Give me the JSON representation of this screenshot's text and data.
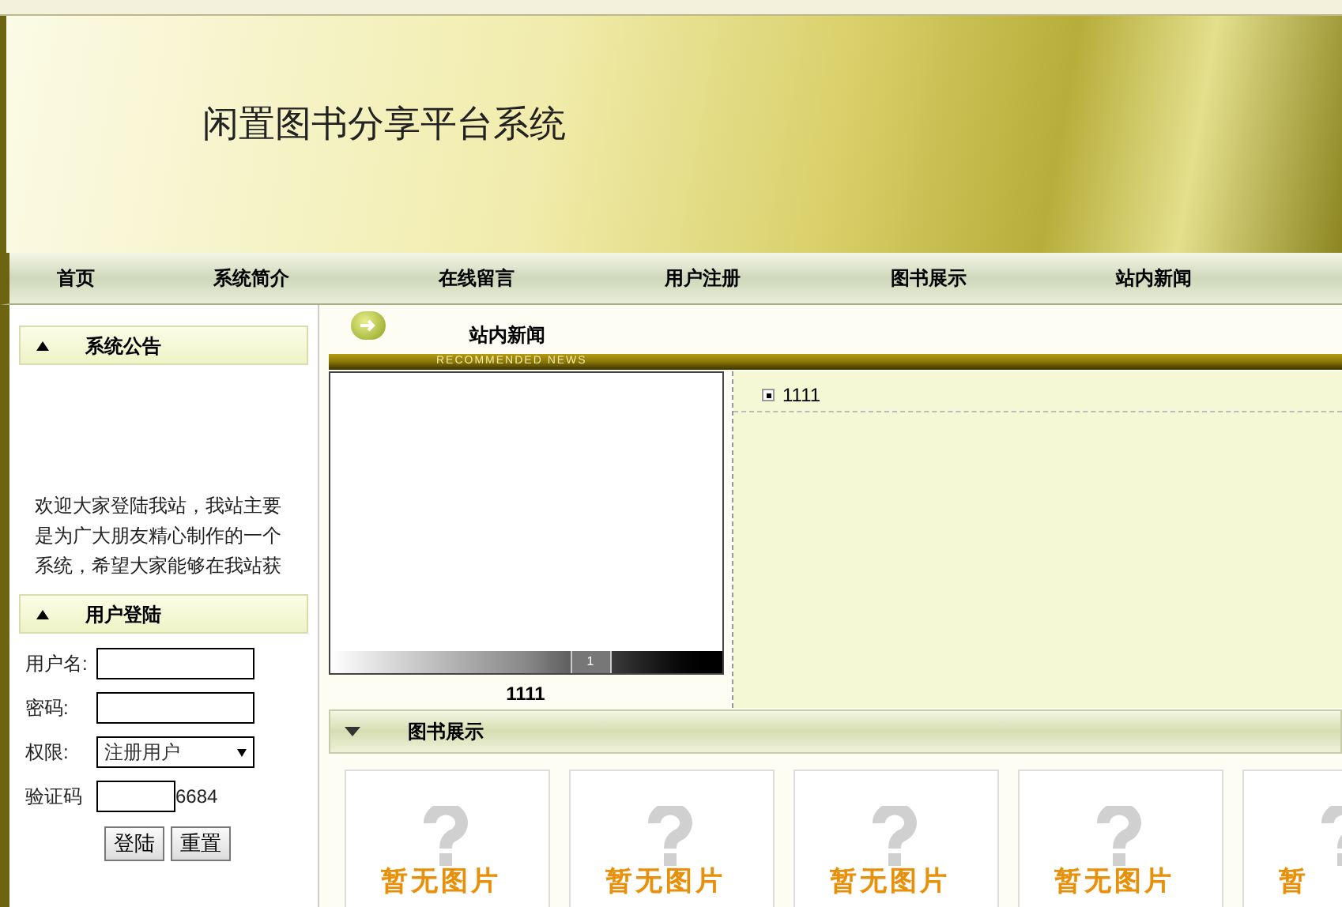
{
  "header": {
    "title": "闲置图书分享平台系统"
  },
  "nav": [
    {
      "label": "首页"
    },
    {
      "label": "系统简介"
    },
    {
      "label": "在线留言"
    },
    {
      "label": "用户注册"
    },
    {
      "label": "图书展示"
    },
    {
      "label": "站内新闻"
    }
  ],
  "announcement": {
    "title": "系统公告",
    "text": "欢迎大家登陆我站，我站主要是为广大朋友精心制作的一个系统，希望大家能够在我站获"
  },
  "login": {
    "title": "用户登陆",
    "fields": [
      {
        "kind": "text",
        "label": "用户名:"
      },
      {
        "kind": "password",
        "label": "密码:"
      },
      {
        "kind": "select",
        "label": "权限:",
        "value": "注册用户"
      },
      {
        "kind": "captcha",
        "label": "验证码",
        "code": "6684"
      }
    ],
    "buttons": [
      "登陆",
      "重置"
    ]
  },
  "news": {
    "title": "站内新闻",
    "subtitle": "RECOMMENDED NEWS",
    "slideshow": {
      "pages": [
        {
          "label": "1",
          "selected": true
        }
      ],
      "caption": "1111"
    },
    "items": [
      "1111"
    ]
  },
  "books": {
    "title": "图书展示",
    "items": [
      {
        "caption": "暂无图片"
      },
      {
        "caption": "暂无图片"
      },
      {
        "caption": "暂无图片"
      },
      {
        "caption": "暂无图片"
      },
      {
        "caption": "暂"
      }
    ]
  }
}
